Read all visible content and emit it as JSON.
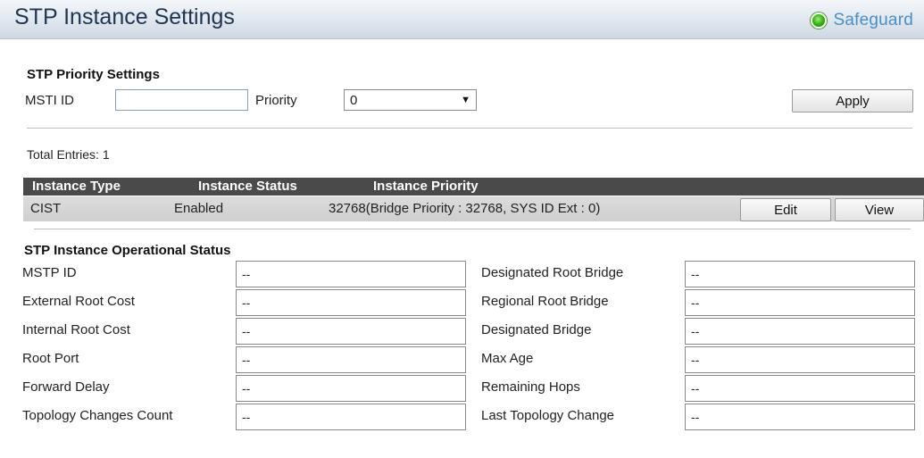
{
  "header": {
    "title": "STP Instance Settings",
    "safeguard_label": "Safeguard",
    "safeguard_color": "#3db819"
  },
  "priority_settings": {
    "section_title": "STP Priority Settings",
    "msti_label": "MSTI ID",
    "msti_value": "",
    "priority_label": "Priority",
    "priority_selected": "0",
    "apply_label": "Apply"
  },
  "table": {
    "total_entries": "Total Entries: 1",
    "columns": [
      "Instance Type",
      "Instance Status",
      "Instance Priority"
    ],
    "rows": [
      {
        "type": "CIST",
        "status": "Enabled",
        "priority": "32768(Bridge Priority : 32768, SYS ID Ext : 0)",
        "edit_label": "Edit",
        "view_label": "View"
      }
    ]
  },
  "operational": {
    "section_title": "STP Instance Operational Status",
    "left": [
      {
        "label": "MSTP ID",
        "value": "--"
      },
      {
        "label": "External Root Cost",
        "value": "--"
      },
      {
        "label": "Internal Root Cost",
        "value": "--"
      },
      {
        "label": "Root Port",
        "value": "--"
      },
      {
        "label": "Forward Delay",
        "value": "--"
      },
      {
        "label": "Topology Changes Count",
        "value": "--"
      }
    ],
    "right": [
      {
        "label": "Designated Root Bridge",
        "value": "--"
      },
      {
        "label": "Regional Root Bridge",
        "value": "--"
      },
      {
        "label": "Designated Bridge",
        "value": "--"
      },
      {
        "label": "Max Age",
        "value": "--"
      },
      {
        "label": "Remaining Hops",
        "value": "--"
      },
      {
        "label": "Last Topology Change",
        "value": "--"
      }
    ]
  }
}
